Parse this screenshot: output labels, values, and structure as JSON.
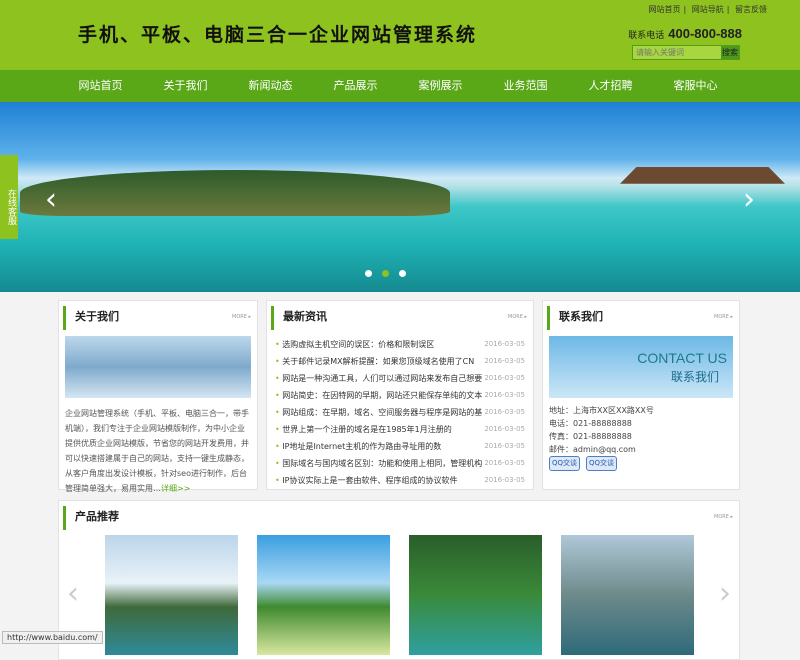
{
  "header": {
    "logo": "手机、平板、电脑三合一企业网站管理系统",
    "toplinks": [
      "网站首页",
      "网站导航",
      "留言反馈"
    ],
    "phone_label": "联系电话",
    "phone": "400-800-888",
    "search_placeholder": "请输入关键词",
    "search_button": "搜索"
  },
  "nav": [
    "网站首页",
    "关于我们",
    "新闻动态",
    "产品展示",
    "案例展示",
    "业务范围",
    "人才招聘",
    "客服中心"
  ],
  "banner": {
    "prev": "‹",
    "next": "›",
    "slides": 3,
    "active_slide": 2,
    "accent": "#8dc21f"
  },
  "kefu": "在线客服",
  "more": "MORE ▸",
  "about": {
    "title": "关于我们",
    "text": "企业网站管理系统（手机、平板、电脑三合一，带手机端），我们专注于企业网站模版制作，为中小企业提供优质企业网站模版，节省您的网站开发费用，并可以快速搭建属于自己的网站，支持一键生成静态，从客户角度出发设计模板，针对seo进行制作，后台管理简单强大，易用实用…",
    "link": "详细>>"
  },
  "news": {
    "title": "最新资讯",
    "items": [
      {
        "t": "选购虚拟主机空间的误区：价格和限制误区",
        "d": "2016-03-05"
      },
      {
        "t": "关于邮件记录MX解析提醒：如果您顶级域名使用了CN",
        "d": "2016-03-05"
      },
      {
        "t": "网站是一种沟通工具，人们可以通过网站来发布自己想要",
        "d": "2016-03-05"
      },
      {
        "t": "网站简史：在因特网的早期，网站还只能保存单纯的文本",
        "d": "2016-03-05"
      },
      {
        "t": "网站组成：在早期，域名、空间服务器与程序是网站的基",
        "d": "2016-03-05"
      },
      {
        "t": "世界上第一个注册的域名是在1985年1月注册的",
        "d": "2016-03-05"
      },
      {
        "t": "IP地址是Internet主机的作为路由寻址用的数",
        "d": "2016-03-05"
      },
      {
        "t": "国际域名与国内域名区别：功能和使用上相同，管理机构",
        "d": "2016-03-05"
      },
      {
        "t": "IP协议实际上是一套由软件、程序组成的协议软件",
        "d": "2016-03-05"
      }
    ]
  },
  "contact": {
    "title": "联系我们",
    "img_en": "CONTACT US",
    "img_cn": "联系我们",
    "address": "地址：上海市XX区XX路XX号",
    "tel": "电话：021-88888888",
    "fax": "传真：021-88888888",
    "email": "邮件：admin@qq.com",
    "qq": "QQ交谈"
  },
  "products": {
    "title": "产品推荐",
    "prev": "‹",
    "next": "›"
  },
  "status": "http://www.baidu.com/"
}
